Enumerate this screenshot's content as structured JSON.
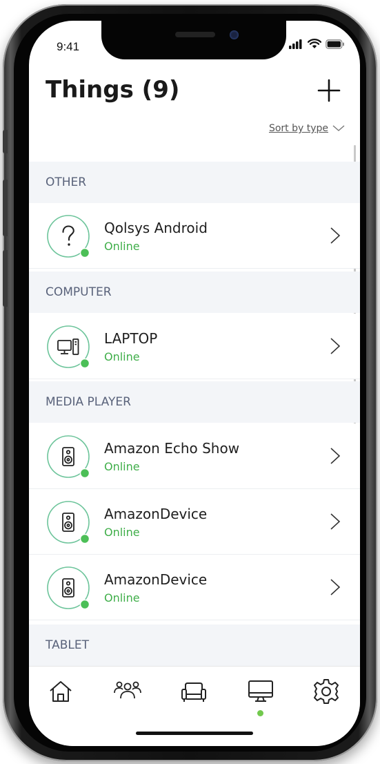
{
  "status_bar": {
    "time": "9:41"
  },
  "header": {
    "title": "Things (9)",
    "add_icon": "plus-icon"
  },
  "sort": {
    "label": "Sort by type",
    "icon": "chevron-down-icon"
  },
  "sections": [
    {
      "title": "OTHER"
    },
    {
      "title": "COMPUTER"
    },
    {
      "title": "MEDIA PLAYER"
    },
    {
      "title": "TABLET"
    }
  ],
  "devices": [
    {
      "name": "Qolsys Android",
      "status": "Online",
      "icon": "question-mark-icon"
    },
    {
      "name": "LAPTOP",
      "status": "Online",
      "icon": "computer-icon"
    },
    {
      "name": "Amazon Echo Show",
      "status": "Online",
      "icon": "speaker-icon"
    },
    {
      "name": "AmazonDevice",
      "status": "Online",
      "icon": "speaker-icon"
    },
    {
      "name": "AmazonDevice",
      "status": "Online",
      "icon": "speaker-icon"
    }
  ],
  "tabbar": {
    "tabs": [
      {
        "icon": "home-icon"
      },
      {
        "icon": "people-icon"
      },
      {
        "icon": "sofa-icon"
      },
      {
        "icon": "monitor-icon",
        "active": true
      },
      {
        "icon": "gear-icon"
      }
    ]
  },
  "colors": {
    "online_green": "#3fae49",
    "circle_green": "#6cc49a",
    "section_bg": "#f3f5f8",
    "section_text": "#59627a"
  }
}
